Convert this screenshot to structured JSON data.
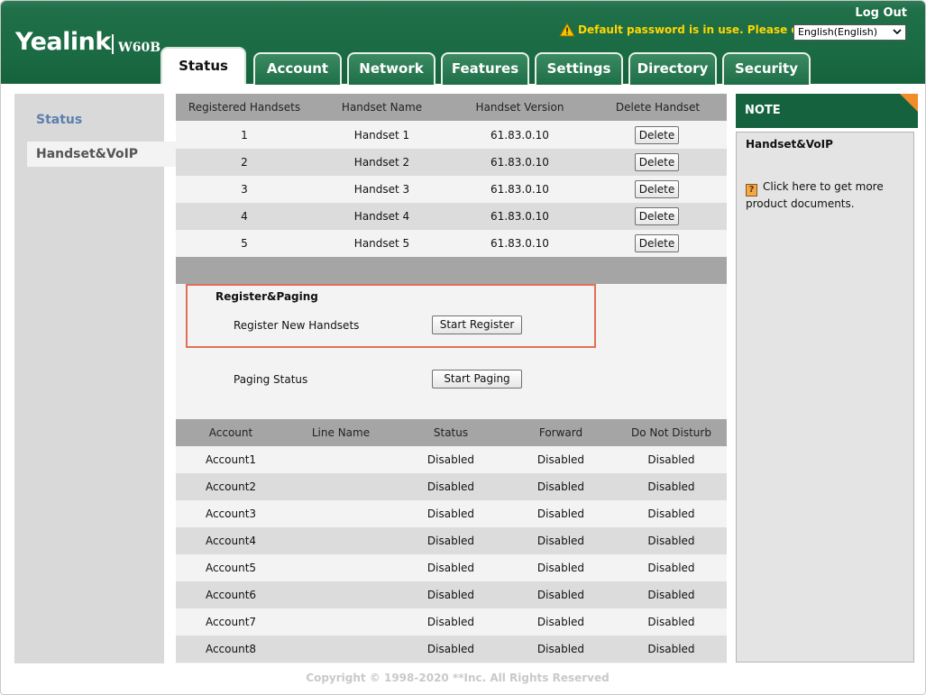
{
  "header": {
    "logo": "Yealink",
    "model": "W60B",
    "logout": "Log Out",
    "warning": "Default password is in use. Please change!",
    "language": "English(English)"
  },
  "tabs": [
    "Status",
    "Account",
    "Network",
    "Features",
    "Settings",
    "Directory",
    "Security"
  ],
  "sidebar": {
    "items": [
      {
        "label": "Status"
      },
      {
        "label": "Handset&VoIP"
      }
    ]
  },
  "handsets": {
    "headers": [
      "Registered Handsets",
      "Handset Name",
      "Handset Version",
      "Delete Handset"
    ],
    "rows": [
      {
        "num": "1",
        "name": "Handset 1",
        "version": "61.83.0.10",
        "action": "Delete"
      },
      {
        "num": "2",
        "name": "Handset 2",
        "version": "61.83.0.10",
        "action": "Delete"
      },
      {
        "num": "3",
        "name": "Handset 3",
        "version": "61.83.0.10",
        "action": "Delete"
      },
      {
        "num": "4",
        "name": "Handset 4",
        "version": "61.83.0.10",
        "action": "Delete"
      },
      {
        "num": "5",
        "name": "Handset 5",
        "version": "61.83.0.10",
        "action": "Delete"
      }
    ]
  },
  "register_paging": {
    "title": "Register&Paging",
    "register_label": "Register New Handsets",
    "register_button": "Start Register",
    "paging_label": "Paging Status",
    "paging_button": "Start Paging"
  },
  "accounts": {
    "headers": [
      "Account",
      "Line Name",
      "Status",
      "Forward",
      "Do Not Disturb"
    ],
    "rows": [
      {
        "account": "Account1",
        "line": "",
        "status": "Disabled",
        "forward": "Disabled",
        "dnd": "Disabled"
      },
      {
        "account": "Account2",
        "line": "",
        "status": "Disabled",
        "forward": "Disabled",
        "dnd": "Disabled"
      },
      {
        "account": "Account3",
        "line": "",
        "status": "Disabled",
        "forward": "Disabled",
        "dnd": "Disabled"
      },
      {
        "account": "Account4",
        "line": "",
        "status": "Disabled",
        "forward": "Disabled",
        "dnd": "Disabled"
      },
      {
        "account": "Account5",
        "line": "",
        "status": "Disabled",
        "forward": "Disabled",
        "dnd": "Disabled"
      },
      {
        "account": "Account6",
        "line": "",
        "status": "Disabled",
        "forward": "Disabled",
        "dnd": "Disabled"
      },
      {
        "account": "Account7",
        "line": "",
        "status": "Disabled",
        "forward": "Disabled",
        "dnd": "Disabled"
      },
      {
        "account": "Account8",
        "line": "",
        "status": "Disabled",
        "forward": "Disabled",
        "dnd": "Disabled"
      }
    ]
  },
  "note": {
    "heading": "NOTE",
    "title": "Handset&VoIP",
    "link_icon": "help-icon",
    "link_text": "Click here to get more product documents."
  },
  "footer": "Copyright © 1998-2020 **Inc. All Rights Reserved",
  "colors": {
    "header_green": "#1a6a43",
    "warning_yellow": "#ffd700",
    "highlight_border": "#e07055",
    "note_corner": "#f28c2a"
  }
}
